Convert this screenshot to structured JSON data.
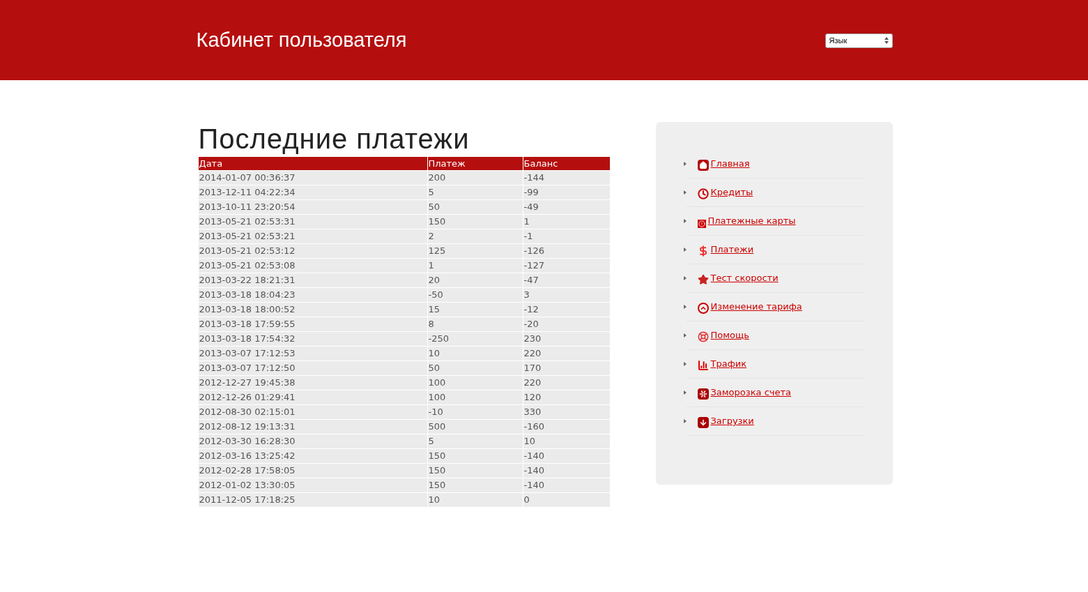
{
  "header": {
    "title": "Кабинет пользователя",
    "language_select": {
      "value": "Язык"
    }
  },
  "payments": {
    "title": "Последние платежи",
    "columns": [
      "Дата",
      "Платеж",
      "Баланс"
    ],
    "rows": [
      [
        "2014-01-07 00:36:37",
        "200",
        "-144"
      ],
      [
        "2013-12-11 04:22:34",
        "5",
        "-99"
      ],
      [
        "2013-10-11 23:20:54",
        "50",
        "-49"
      ],
      [
        "2013-05-21 02:53:31",
        "150",
        "1"
      ],
      [
        "2013-05-21 02:53:21",
        "2",
        "-1"
      ],
      [
        "2013-05-21 02:53:12",
        "125",
        "-126"
      ],
      [
        "2013-05-21 02:53:08",
        "1",
        "-127"
      ],
      [
        "2013-03-22 18:21:31",
        "20",
        "-47"
      ],
      [
        "2013-03-18 18:04:23",
        "-50",
        "3"
      ],
      [
        "2013-03-18 18:00:52",
        "15",
        "-12"
      ],
      [
        "2013-03-18 17:59:55",
        "8",
        "-20"
      ],
      [
        "2013-03-18 17:54:32",
        "-250",
        "230"
      ],
      [
        "2013-03-07 17:12:53",
        "10",
        "220"
      ],
      [
        "2013-03-07 17:12:50",
        "50",
        "170"
      ],
      [
        "2012-12-27 19:45:38",
        "100",
        "220"
      ],
      [
        "2012-12-26 01:29:41",
        "100",
        "120"
      ],
      [
        "2012-08-30 02:15:01",
        "-10",
        "330"
      ],
      [
        "2012-08-12 19:13:31",
        "500",
        "-160"
      ],
      [
        "2012-03-30 16:28:30",
        "5",
        "10"
      ],
      [
        "2012-03-16 13:25:42",
        "150",
        "-140"
      ],
      [
        "2012-02-28 17:58:05",
        "150",
        "-140"
      ],
      [
        "2012-01-02 13:30:05",
        "150",
        "-140"
      ],
      [
        "2011-12-05 17:18:25",
        "10",
        "0"
      ]
    ]
  },
  "sidebar": {
    "items": [
      {
        "kind": "home",
        "label": "Главная"
      },
      {
        "kind": "clock",
        "label": "Кредиты"
      },
      {
        "kind": "alert",
        "label": "Платежные карты"
      },
      {
        "kind": "dollar",
        "label": "Платежи"
      },
      {
        "kind": "star",
        "label": "Тест скорости"
      },
      {
        "kind": "tariff",
        "label": "Изменение тарифа"
      },
      {
        "kind": "help",
        "label": "Помощь"
      },
      {
        "kind": "traffic",
        "label": "Трафик"
      },
      {
        "kind": "freeze",
        "label": "Заморозка счета"
      },
      {
        "kind": "download",
        "label": "Загрузки"
      }
    ]
  }
}
